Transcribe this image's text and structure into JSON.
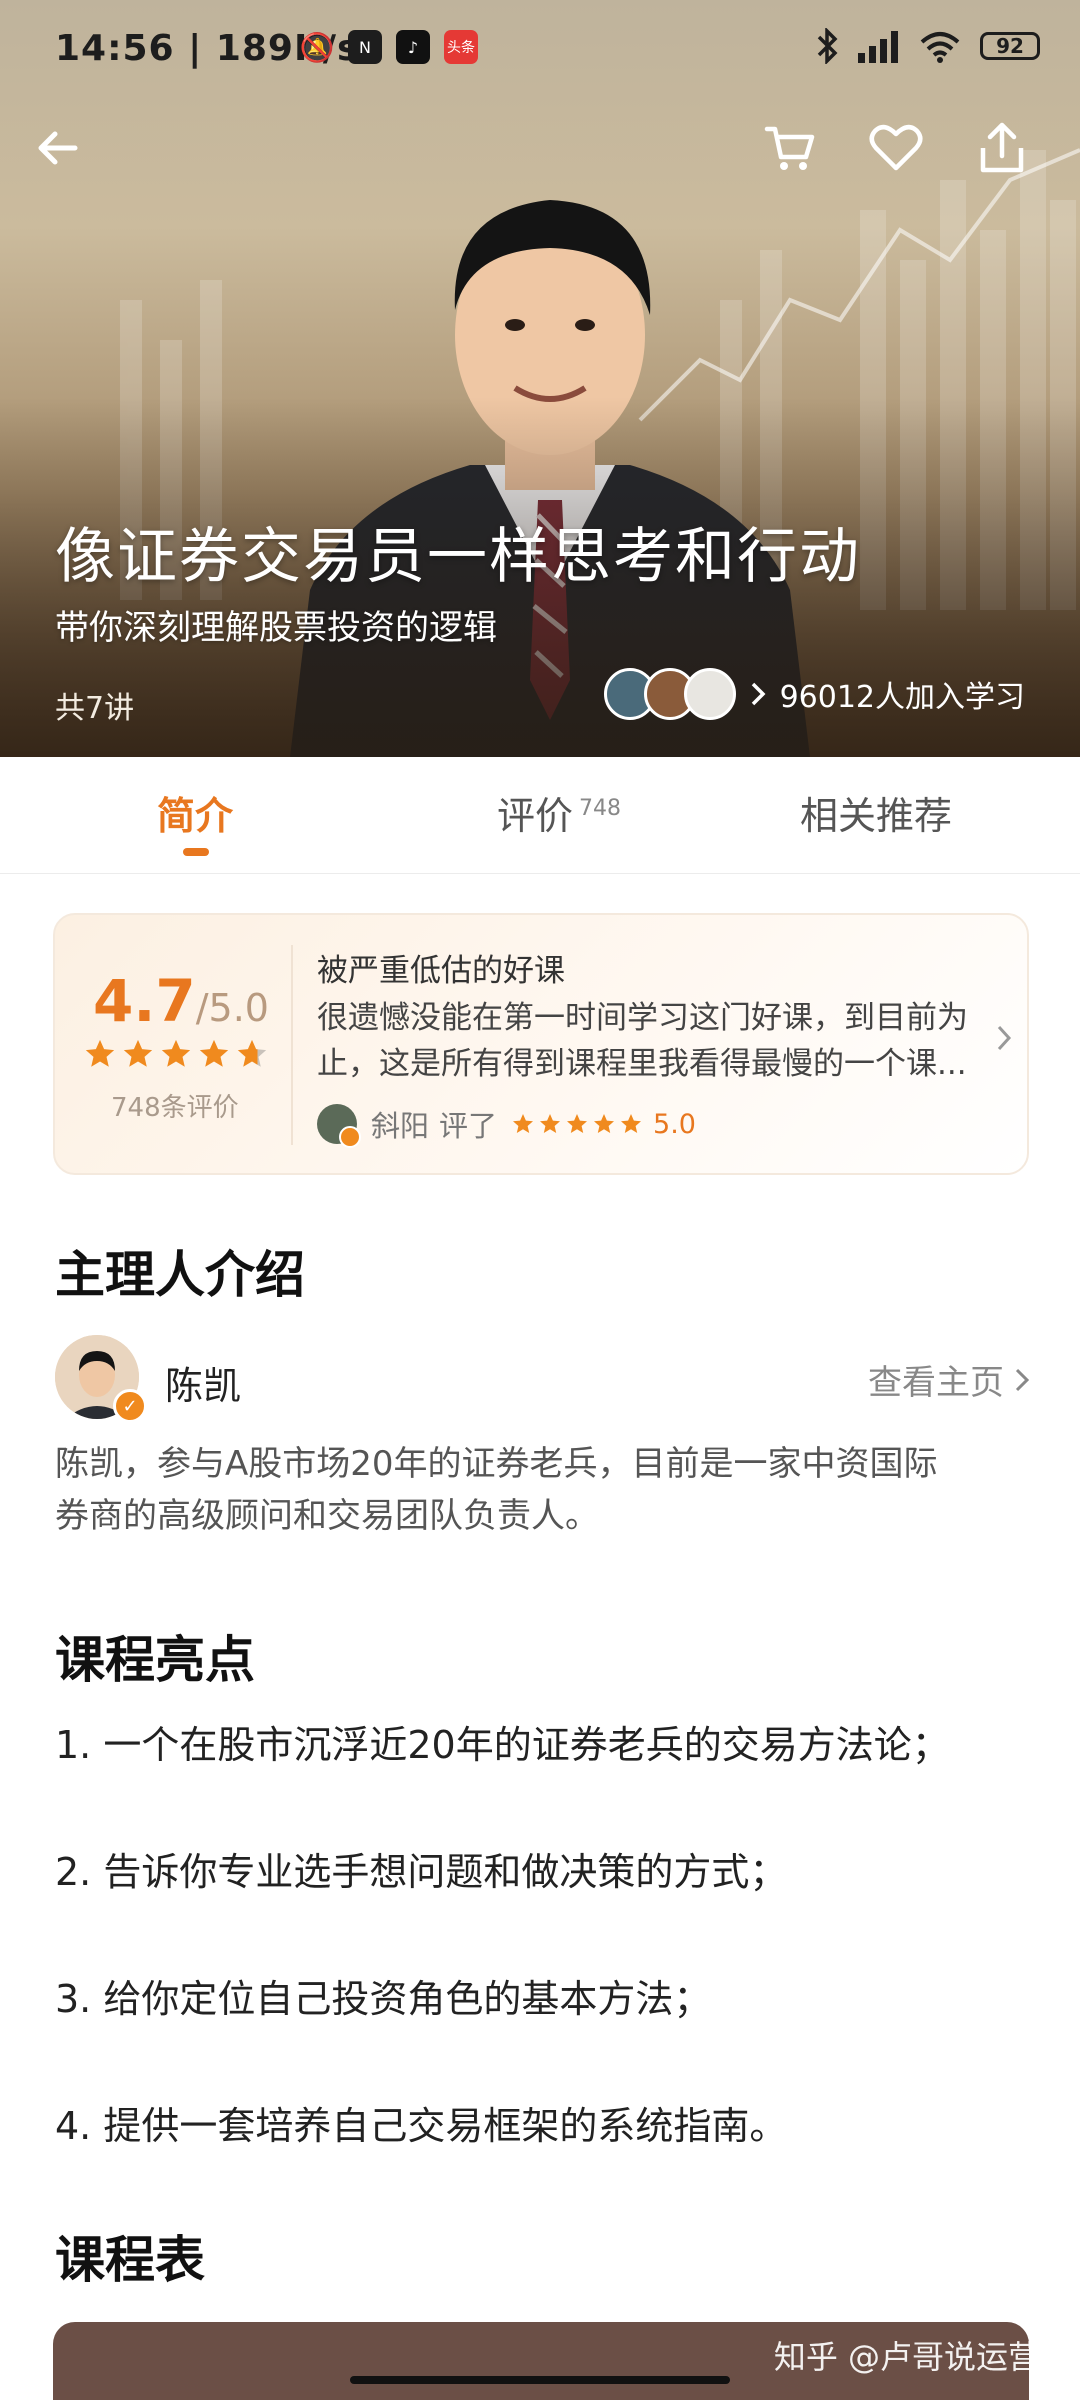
{
  "status_bar": {
    "time": "14:56",
    "speed": "189K/s",
    "app_badge": "头条",
    "battery": "92"
  },
  "hero": {
    "title": "像证券交易员一样思考和行动",
    "subtitle": "带你深刻理解股票投资的逻辑",
    "lecture_count": "共7讲",
    "learners": "96012人加入学习"
  },
  "tabs": [
    {
      "label": "简介",
      "badge": ""
    },
    {
      "label": "评价",
      "badge": "748"
    },
    {
      "label": "相关推荐",
      "badge": ""
    }
  ],
  "rating": {
    "score": "4.7",
    "max": "/5.0",
    "count_label": "748条评价",
    "stars": 4.7,
    "review_title": "被严重低估的好课",
    "review_line1": "很遗憾没能在第一时间学习这门好课，到目前为",
    "review_line2": "止，这是所有得到课程里我看得最慢的一个课...",
    "reviewer_name": "斜阳",
    "reviewer_action": "评了",
    "reviewer_score": "5.0",
    "reviewer_stars": 5
  },
  "host": {
    "section_title": "主理人介绍",
    "name": "陈凯",
    "link": "查看主页",
    "intro_line1": "陈凯，参与A股市场20年的证券老兵，目前是一家中资国际",
    "intro_line2": "券商的高级顾问和交易团队负责人。"
  },
  "highlights": {
    "section_title": "课程亮点",
    "items": [
      "1. 一个在股市沉浮近20年的证券老兵的交易方法论；",
      "2. 告诉你专业选手想问题和做决策的方式；",
      "3. 给你定位自己投资角色的基本方法；",
      "4. 提供一套培养自己交易框架的系统指南。"
    ]
  },
  "schedule": {
    "section_title": "课程表"
  },
  "watermark": "知乎 @卢哥说运营",
  "colors": {
    "accent": "#e8771f",
    "card_bg": "#fcf0e2",
    "schedule_bar": "#6b4f46"
  }
}
